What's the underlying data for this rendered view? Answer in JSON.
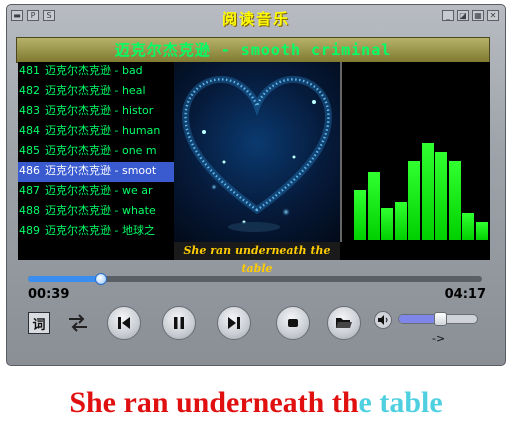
{
  "app": {
    "title": "阅读音乐",
    "left_icons": [
      "minimize-icon",
      "letter-p-icon",
      "letter-s-icon"
    ],
    "right_icons": [
      "minimize-icon",
      "restore-icon",
      "skin-icon",
      "close-icon"
    ]
  },
  "now_playing": {
    "banner": "迈克尔杰克逊 - smooth criminal",
    "lyric_line": "She ran underneath the table"
  },
  "playlist": {
    "items": [
      {
        "num": "481",
        "text": "迈克尔杰克逊 - bad"
      },
      {
        "num": "482",
        "text": "迈克尔杰克逊 - heal"
      },
      {
        "num": "483",
        "text": "迈克尔杰克逊 - histor"
      },
      {
        "num": "484",
        "text": "迈克尔杰克逊 - human"
      },
      {
        "num": "485",
        "text": "迈克尔杰克逊 - one m"
      },
      {
        "num": "486",
        "text": "迈克尔杰克逊 - smoot"
      },
      {
        "num": "487",
        "text": "迈克尔杰克逊 - we ar"
      },
      {
        "num": "488",
        "text": "迈克尔杰克逊 - whate"
      },
      {
        "num": "489",
        "text": "迈克尔杰克逊 - 地球之"
      }
    ],
    "selected_index": 5
  },
  "visualizer": {
    "levels": [
      0.28,
      0.38,
      0.18,
      0.21,
      0.44,
      0.54,
      0.49,
      0.44,
      0.15,
      0.1
    ]
  },
  "progress": {
    "current": "00:39",
    "total": "04:17",
    "fraction": 0.16
  },
  "controls": {
    "lyric_label": "词",
    "arrow_label": "->",
    "volume_fraction": 0.52
  },
  "caption": {
    "part_a": "She ran underneath th",
    "part_b": "e table"
  },
  "colors": {
    "accent": "#3a8ef0",
    "playlist_text": "#00ff66",
    "title": "#ffff00",
    "caption_red": "#e01010",
    "caption_cyan": "#4fd0e0"
  }
}
